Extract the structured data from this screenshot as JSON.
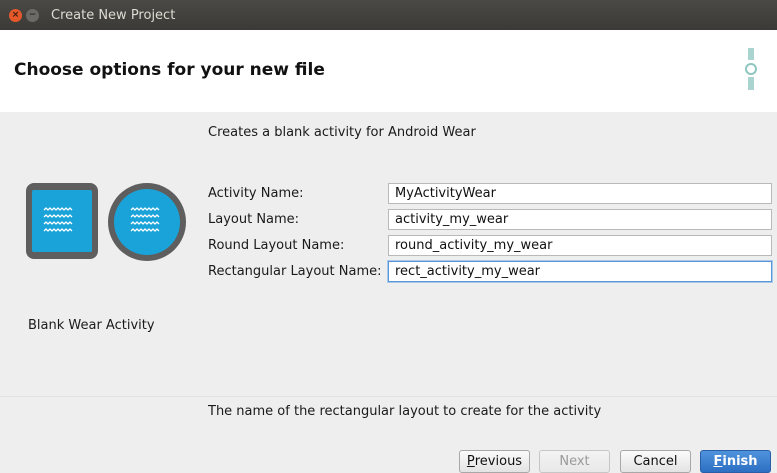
{
  "window": {
    "title": "Create New Project"
  },
  "header": {
    "title": "Choose options for your new file"
  },
  "description": "Creates a blank activity for Android Wear",
  "template": {
    "name": "Blank Wear Activity"
  },
  "form": {
    "fields": [
      {
        "label": "Activity Name:",
        "value": "MyActivityWear"
      },
      {
        "label": "Layout Name:",
        "value": "activity_my_wear"
      },
      {
        "label": "Round Layout Name:",
        "value": "round_activity_my_wear"
      },
      {
        "label": "Rectangular Layout Name:",
        "value": "rect_activity_my_wear"
      }
    ]
  },
  "help_text": "The name of the rectangular layout to create for the activity",
  "buttons": {
    "previous": {
      "mnemonic": "P",
      "rest": "revious"
    },
    "next": "Next",
    "cancel": "Cancel",
    "finish": {
      "mnemonic": "F",
      "rest": "inish"
    }
  },
  "colors": {
    "accent": "#2d6fc2",
    "wear_preview_blue": "#1aa3d9",
    "focus_border": "#5a96d6"
  }
}
